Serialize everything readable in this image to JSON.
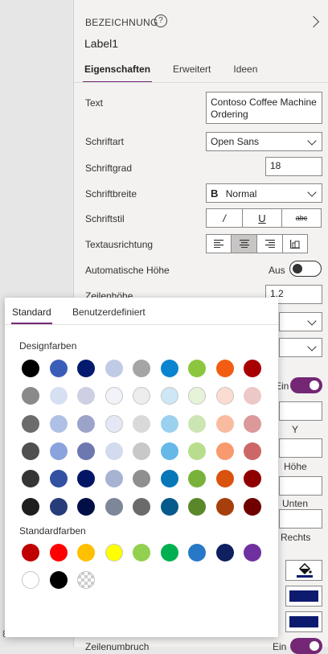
{
  "header": {
    "type_label": "BEZEICHNUNG",
    "control_name": "Label1"
  },
  "tabs": [
    {
      "label": "Eigenschaften",
      "active": true
    },
    {
      "label": "Erweitert",
      "active": false
    },
    {
      "label": "Ideen",
      "active": false
    }
  ],
  "properties": {
    "text_label": "Text",
    "text_value_line1": "Contoso Coffee Machine",
    "text_value_line2": "Ordering",
    "font_label": "Schriftart",
    "font_value": "Open Sans",
    "size_label": "Schriftgrad",
    "size_value": "18",
    "weight_label": "Schriftbreite",
    "weight_icon": "B",
    "weight_value": "Normal",
    "style_label": "Schriftstil",
    "style_italic": "/",
    "style_underline": "U",
    "style_strike": "abc",
    "align_label": "Textausrichtung",
    "autoheight_label": "Automatische Höhe",
    "autoheight_value": "Aus",
    "lineheight_label": "Zeilenhöhe",
    "lineheight_value": "1.2",
    "visible_value": "Ein",
    "y_label": "Y",
    "height_label": "Höhe",
    "bottom_label": "Unten",
    "right_label": "Rechts",
    "wrap_label": "Zeilenumbruch",
    "wrap_value": "Ein",
    "left_edge_fragment": "8"
  },
  "color_picker": {
    "tabs": [
      {
        "label": "Standard",
        "active": true
      },
      {
        "label": "Benutzerdefiniert",
        "active": false
      }
    ],
    "design_title": "Designfarben",
    "standard_title": "Standardfarben",
    "design_colors": [
      [
        "#000000",
        "#3a5eb8",
        "#041a6e",
        "#c0cce5",
        "#a5a5a5",
        "#0a84cf",
        "#8cc63f",
        "#f25d13",
        "#a80000"
      ],
      [
        "#8a8a8a",
        "#d7dff2",
        "#cdd0e3",
        "#f1f3f9",
        "#ededed",
        "#cde7f7",
        "#e6f3d8",
        "#fcdcd1",
        "#edc8c8"
      ],
      [
        "#6c6c6c",
        "#afc0e5",
        "#9ba3c9",
        "#e3e8f4",
        "#d9d9d9",
        "#9bd0ef",
        "#cce6b3",
        "#f9bb9f",
        "#dc9999"
      ],
      [
        "#505050",
        "#8ba3dc",
        "#6d78b0",
        "#d3dbee",
        "#c8c8c8",
        "#66b8e8",
        "#b8dd8c",
        "#f79a6e",
        "#cd6767"
      ],
      [
        "#353535",
        "#3350a2",
        "#031666",
        "#a6b3d1",
        "#8f8f8f",
        "#0877b8",
        "#79b23a",
        "#d9530f",
        "#8f0000"
      ],
      [
        "#1e1e1e",
        "#263d7a",
        "#020f47",
        "#7d8799",
        "#6b6b6b",
        "#065a8b",
        "#5b872b",
        "#a63f0b",
        "#700000"
      ]
    ],
    "standard_colors": [
      [
        "#c00000",
        "#ff0000",
        "#ffc000",
        "#ffff00",
        "#92d050",
        "#00b050",
        "#2878c8",
        "#0e2060",
        "#7030a0"
      ],
      [
        "#ffffff",
        "#000000",
        "transparent"
      ]
    ]
  },
  "accent_color": "#742774",
  "swatch_color_navy": "#0d1b6e"
}
